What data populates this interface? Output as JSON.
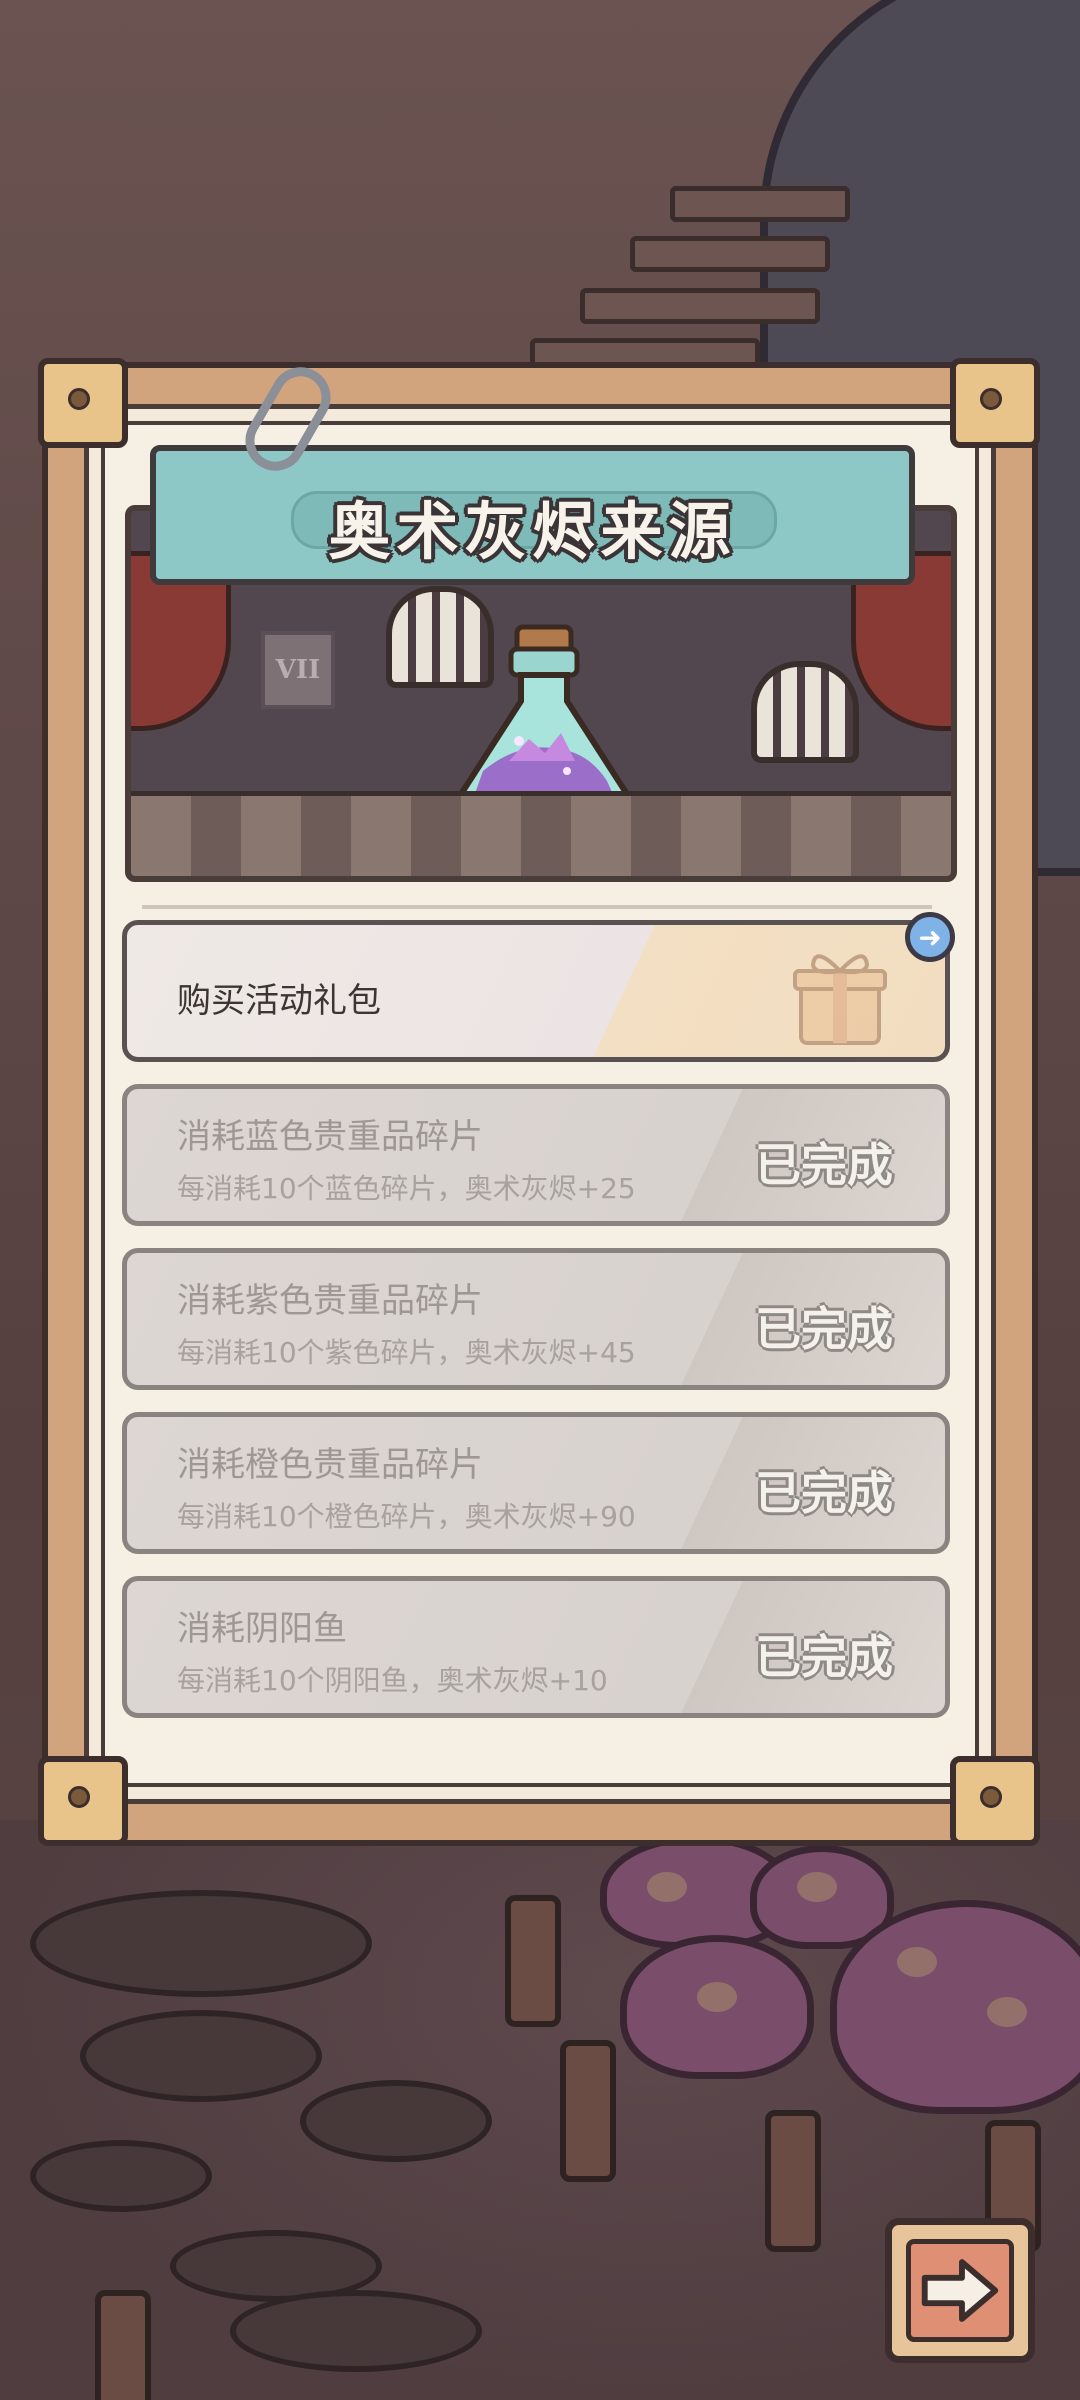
{
  "dialog": {
    "title": "奥术灰烬来源",
    "scene_plaque": "VII"
  },
  "sources": [
    {
      "name": "购买活动礼包",
      "state": "active"
    },
    {
      "name": "消耗蓝色贵重品碎片",
      "desc": "每消耗10个蓝色碎片，奥术灰烬+25",
      "status": "已完成"
    },
    {
      "name": "消耗紫色贵重品碎片",
      "desc": "每消耗10个紫色碎片，奥术灰烬+45",
      "status": "已完成"
    },
    {
      "name": "消耗橙色贵重品碎片",
      "desc": "每消耗10个橙色碎片，奥术灰烬+90",
      "status": "已完成"
    },
    {
      "name": "消耗阴阳鱼",
      "desc": "每消耗10个阴阳鱼，奥术灰烬+10",
      "status": "已完成"
    }
  ],
  "icons": {
    "go": "arrow-right-circle-icon",
    "next": "arrow-right-icon",
    "gift": "gift-box-icon",
    "potion": "arcane-ash-potion-icon",
    "clip": "paperclip-icon"
  },
  "colors": {
    "banner": "#8ec8c6",
    "card_frame": "#d2a47d",
    "paper": "#f6f0e4",
    "go_button": "#7fb3e8",
    "next_button": "#df8f74"
  }
}
